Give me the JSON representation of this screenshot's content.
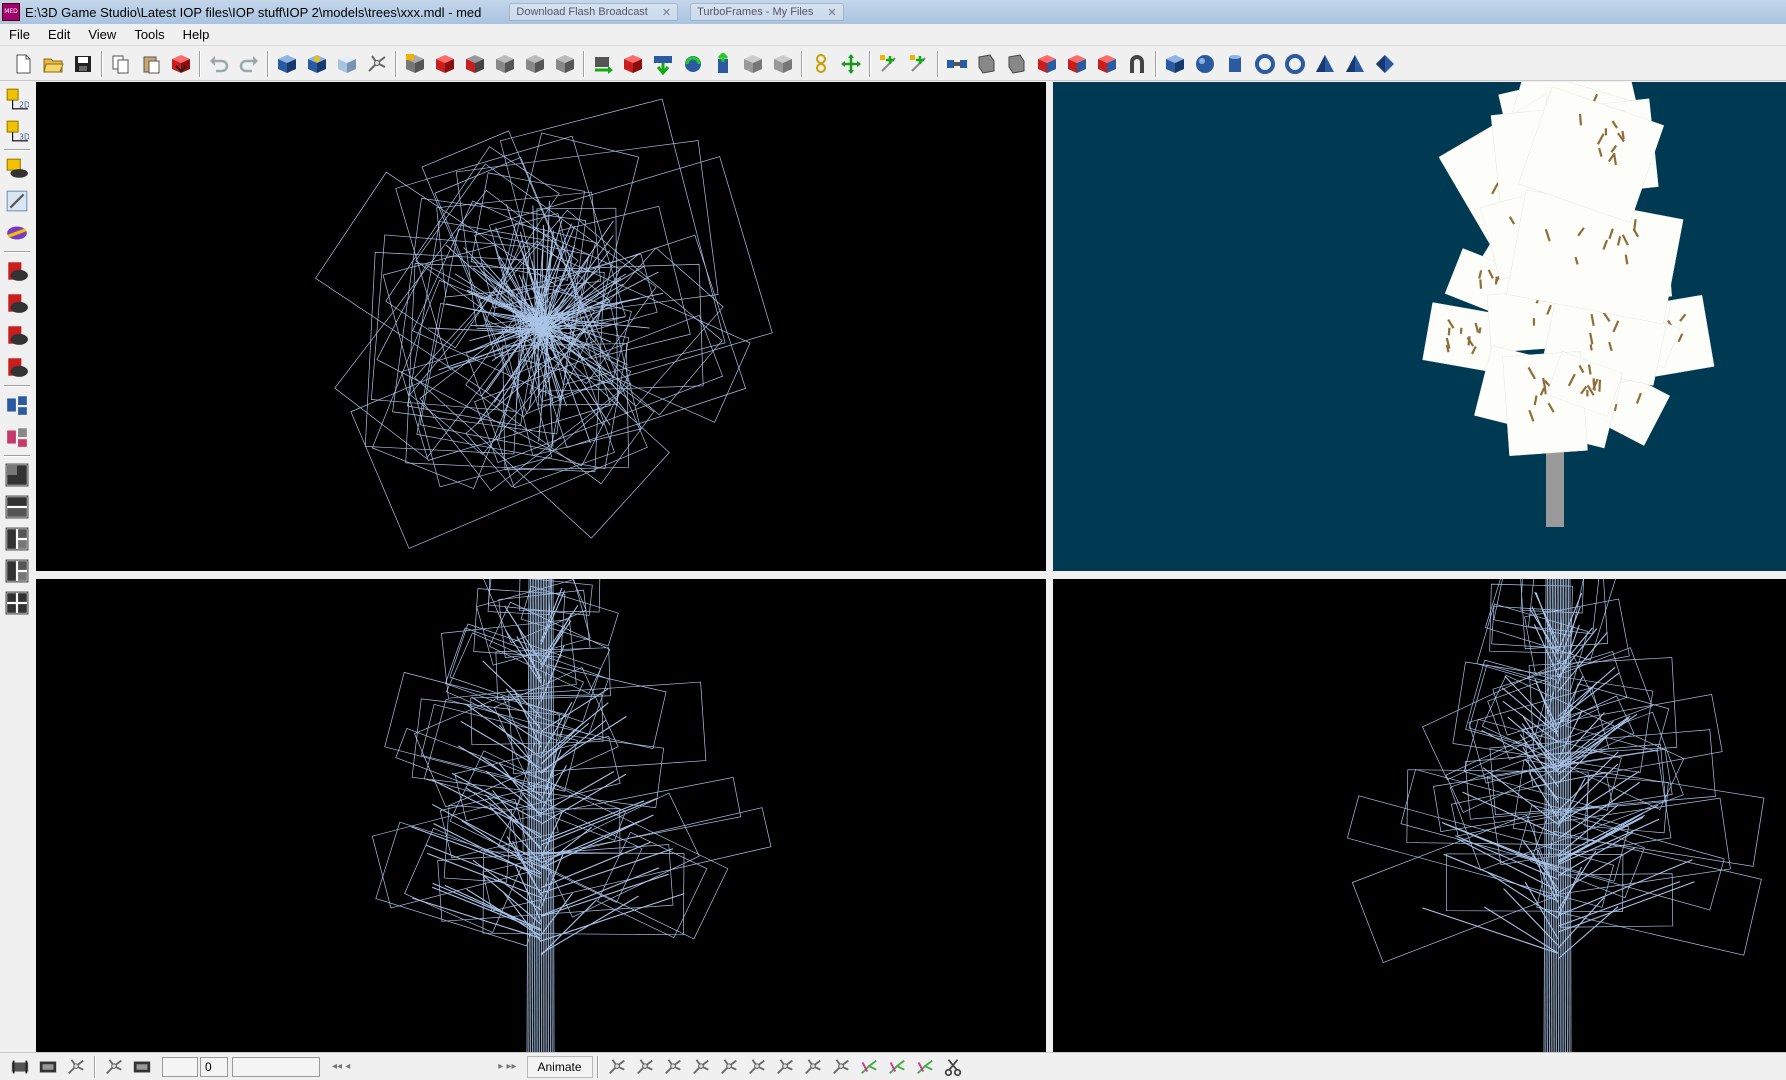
{
  "window": {
    "title": "E:\\3D Game Studio\\Latest IOP files\\IOP stuff\\IOP 2\\models\\trees\\xxx.mdl - med",
    "app_icon_label": "MED",
    "background_tabs": [
      "Download Flash Broadcast",
      "TurboFrames - My Files"
    ]
  },
  "menu": {
    "items": [
      {
        "label": "File"
      },
      {
        "label": "Edit"
      },
      {
        "label": "View"
      },
      {
        "label": "Tools"
      },
      {
        "label": "Help"
      }
    ]
  },
  "toolbar": {
    "groups": [
      [
        "new-file-icon",
        "open-folder-icon",
        "save-icon"
      ],
      [
        "copy-icon",
        "paste-icon",
        "import-icon"
      ],
      [
        "undo-icon",
        "redo-icon"
      ],
      [
        "cube-blue-icon",
        "cube-gear-icon",
        "cube-light-icon",
        "bones-icon"
      ],
      [
        "add-vertex-icon",
        "select-vertices-icon",
        "select-faces-icon",
        "select-all-icon",
        "select-none-icon",
        "invert-selection-icon"
      ],
      [
        "move-camera-icon",
        "move-object-icon",
        "move-down-icon",
        "rotate-icon",
        "scale-icon",
        "mirror-icon",
        "flip-icon"
      ],
      [
        "weld-icon",
        "center-icon"
      ],
      [
        "add-bone-icon",
        "link-bone-icon"
      ],
      [
        "bridge-icon",
        "extrude-icon",
        "cut-icon",
        "paint-face-icon",
        "paint-face2-icon",
        "paint-face3-icon",
        "magnet-icon"
      ],
      [
        "cube-primitive-icon",
        "sphere-primitive-icon",
        "cylinder-primitive-icon",
        "torus-primitive-icon",
        "ring-primitive-icon",
        "cone-primitive-icon",
        "pyramid-primitive-icon",
        "diamond-primitive-icon"
      ]
    ]
  },
  "left_toolbar": {
    "groups": [
      [
        "view-2d-icon",
        "view-3d-icon"
      ],
      [
        "lock-view-icon",
        "edit-view-icon",
        "render-mode-icon"
      ],
      [
        "wire-mode-icon",
        "solid-mode-icon",
        "textured-mode-icon",
        "shaded-mode-icon"
      ],
      [
        "show-vertices-icon",
        "show-faces-icon"
      ],
      [
        "layout-single-icon",
        "layout-two-icon",
        "layout-three-icon",
        "layout-three-b-icon",
        "layout-four-icon"
      ]
    ]
  },
  "viewports": {
    "top": {
      "mode": "wireframe"
    },
    "perspective": {
      "mode": "textured"
    },
    "front": {
      "mode": "wireframe"
    },
    "side": {
      "mode": "wireframe"
    }
  },
  "colors": {
    "wireframe": "#aac4e8",
    "viewport_bg": "#000000",
    "perspective_bg": "#003a52",
    "leaf_card": "#fdfdfa",
    "leaf_texture": "#8e6d3a",
    "trunk": "#9a9a9a"
  },
  "bottom_bar": {
    "frame_value": "0",
    "animate_label": "Animate",
    "nav_prev": "◂◂ ◂",
    "nav_next": "▸ ▸▸",
    "tools": [
      "vertex-edit-icon",
      "face-edit-icon",
      "skin-edit-icon",
      "bone-edit-icon",
      "bone-edit2-icon",
      "bone-edit3-icon",
      "bone-edit4-icon",
      "bone-edit5-icon",
      "bone-edit6-icon",
      "bone-color-icon",
      "bone-color2-icon",
      "bone-paint-icon",
      "scissor-icon"
    ]
  }
}
